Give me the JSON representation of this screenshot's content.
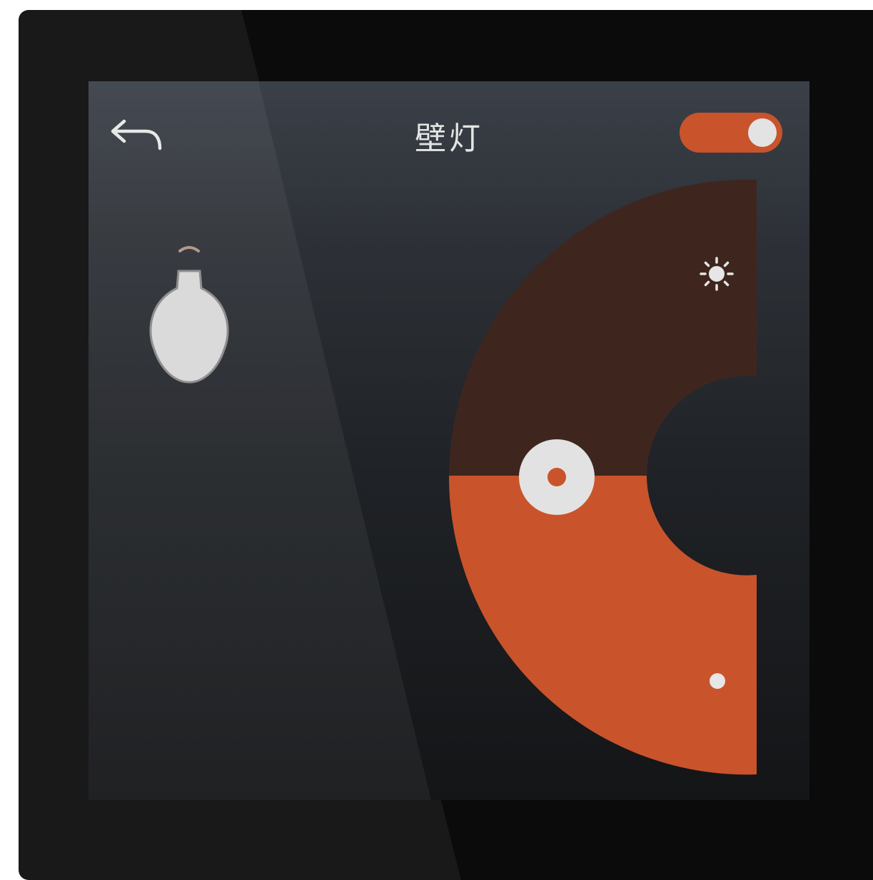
{
  "header": {
    "back_icon": "back-arrow-icon",
    "title": "壁灯",
    "power_toggle": {
      "on": true,
      "color": "#c9532b"
    }
  },
  "light": {
    "icon": "light-bulb-icon",
    "brightness_level": 0.5
  },
  "dimmer": {
    "max_icon": "sun-icon",
    "min_icon": "dot-icon",
    "active_color": "#c9532b",
    "inactive_color": "#3e261f",
    "handle_color": "#e2e2e2"
  }
}
